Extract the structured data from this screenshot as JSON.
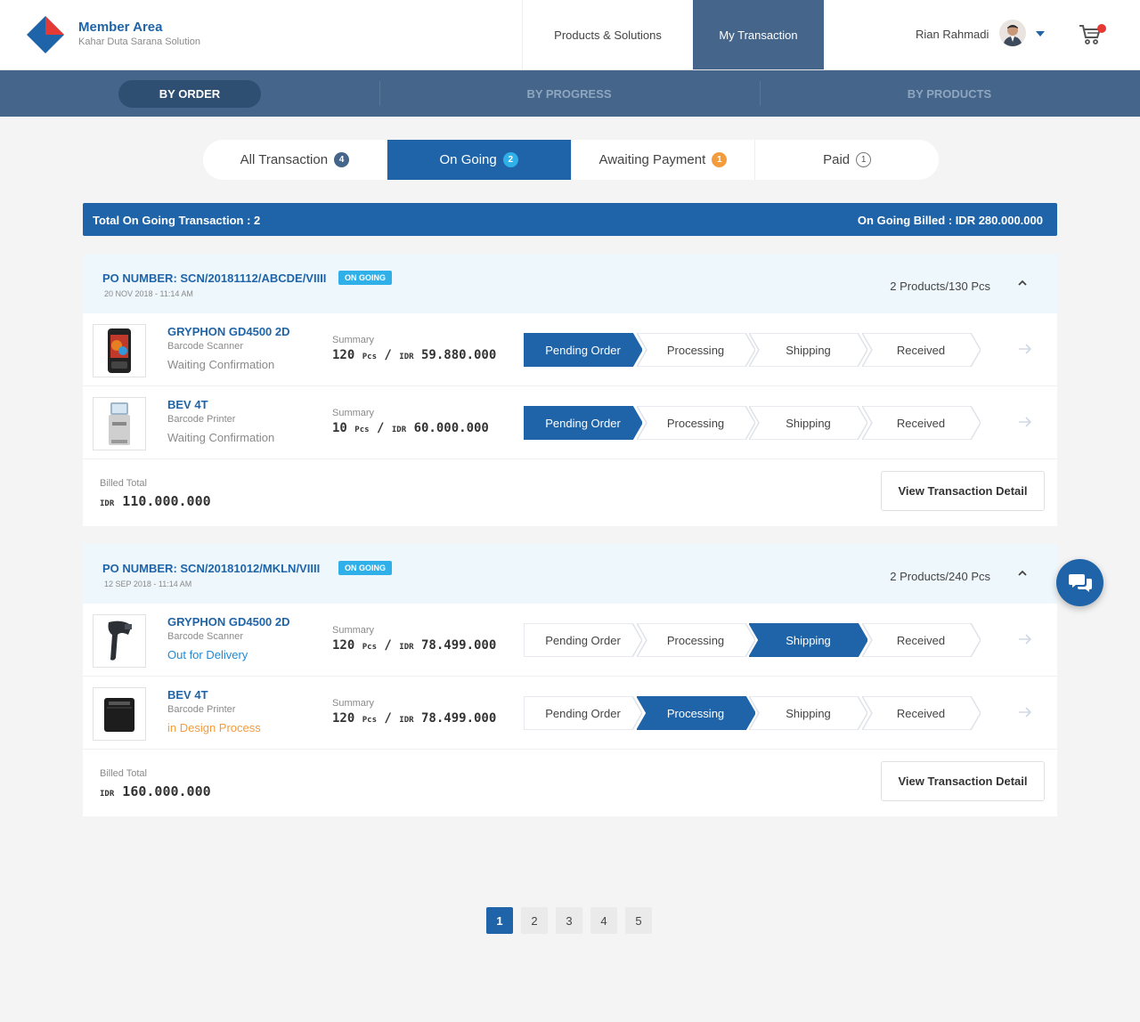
{
  "header": {
    "brand_title": "Member Area",
    "brand_subtitle": "Kahar Duta Sarana Solution",
    "nav": [
      "Products & Solutions",
      "My Transaction"
    ],
    "user_name": "Rian Rahmadi"
  },
  "subnav": [
    "BY ORDER",
    "BY PROGRESS",
    "BY PRODUCTS"
  ],
  "tabs": [
    {
      "label": "All Transaction",
      "count": "4"
    },
    {
      "label": "On Going",
      "count": "2"
    },
    {
      "label": "Awaiting Payment",
      "count": "1"
    },
    {
      "label": "Paid",
      "count": "1"
    }
  ],
  "summary": {
    "left": "Total On Going Transaction : 2",
    "right": "On Going Billed : IDR 280.000.000"
  },
  "steps": [
    "Pending Order",
    "Processing",
    "Shipping",
    "Received"
  ],
  "summary_label": "Summary",
  "billed_label": "Billed Total",
  "pcs_unit": "Pcs",
  "idr_unit": "IDR",
  "detail_button": "View Transaction Detail",
  "orders": [
    {
      "po": "PO NUMBER: SCN/20181112/ABCDE/VIIII",
      "status": "ON GOING",
      "date": "20 NOV 2018 - 11:14 AM",
      "count": "2 Products/130 Pcs",
      "items": [
        {
          "name": "GRYPHON GD4500 2D",
          "category": "Barcode Scanner",
          "status": "Waiting Confirmation",
          "qty": "120",
          "amount": "59.880.000",
          "active_step": 0
        },
        {
          "name": "BEV 4T",
          "category": "Barcode Printer",
          "status": "Waiting Confirmation",
          "qty": "10",
          "amount": "60.000.000",
          "active_step": 0
        }
      ],
      "billed_total": "110.000.000"
    },
    {
      "po": "PO NUMBER: SCN/20181012/MKLN/VIIII",
      "status": "ON GOING",
      "date": "12 SEP 2018 - 11:14 AM",
      "count": "2 Products/240 Pcs",
      "items": [
        {
          "name": "GRYPHON GD4500 2D",
          "category": "Barcode Scanner",
          "status": "Out for Delivery",
          "qty": "120",
          "amount": "78.499.000",
          "active_step": 2
        },
        {
          "name": "BEV 4T",
          "category": "Barcode Printer",
          "status": "in Design Process",
          "qty": "120",
          "amount": "78.499.000",
          "active_step": 1
        }
      ],
      "billed_total": "160.000.000"
    }
  ],
  "pagination": [
    "1",
    "2",
    "3",
    "4",
    "5"
  ],
  "colors": {
    "primary": "#1f64a8",
    "nav": "#45658a",
    "accent": "#2fb0e8",
    "orange": "#f39c3d"
  }
}
